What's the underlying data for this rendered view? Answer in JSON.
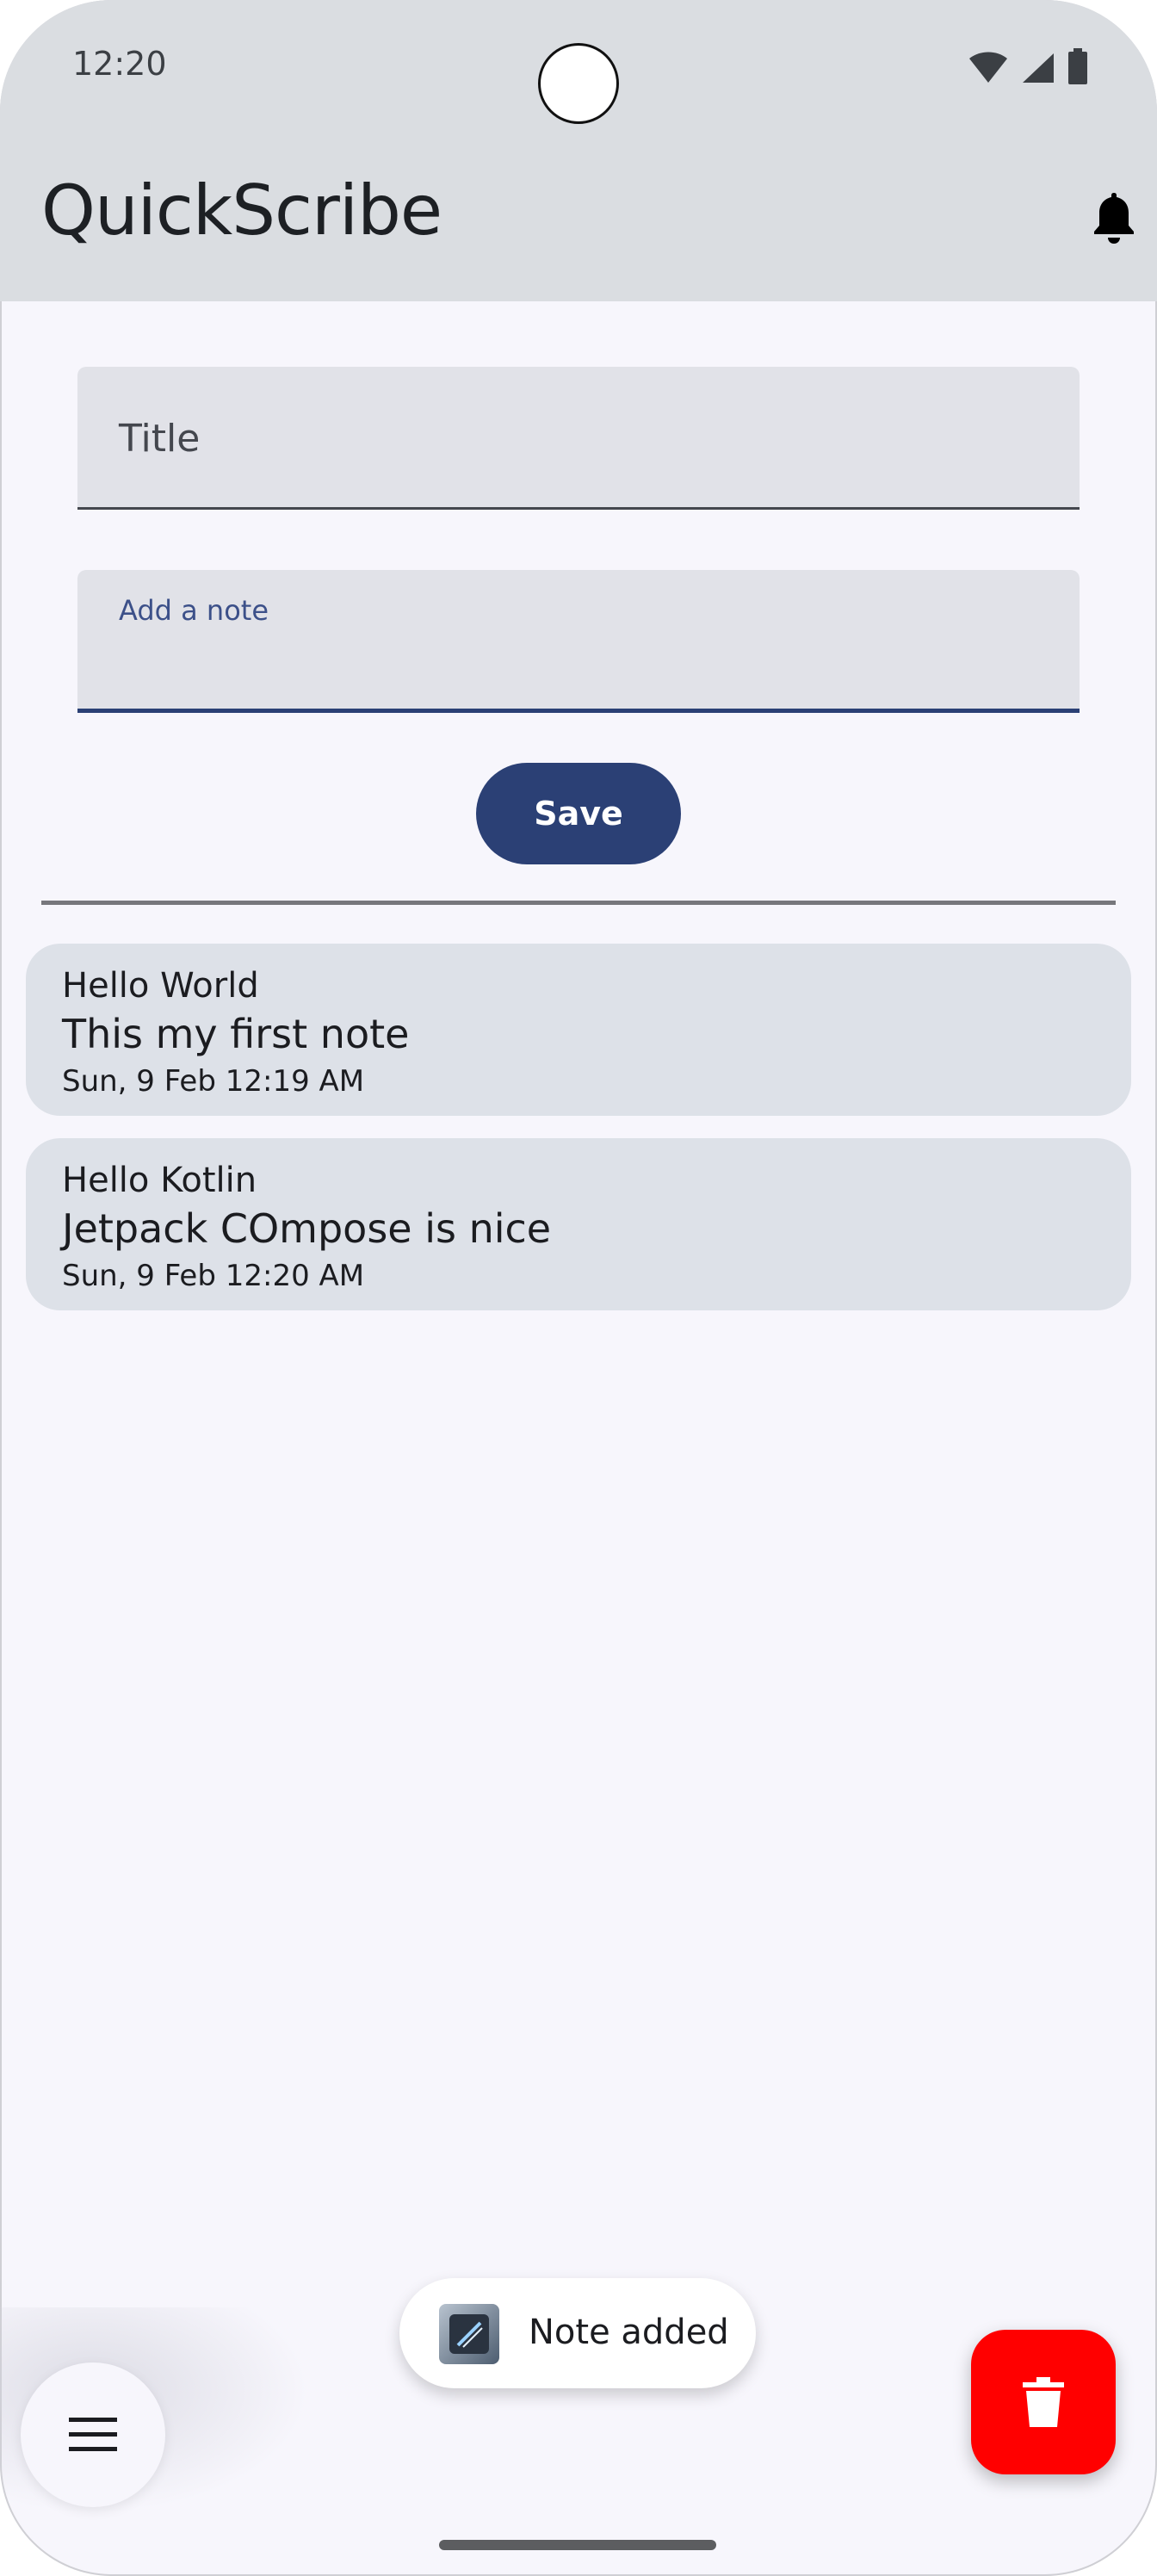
{
  "status_bar": {
    "time": "12:20",
    "icons": [
      "wifi-icon",
      "cellular-signal-icon",
      "battery-icon"
    ]
  },
  "app_bar": {
    "title": "QuickScribe",
    "action_icon": "notification-bell-icon"
  },
  "form": {
    "title_placeholder": "Title",
    "note_label": "Add a note",
    "save_label": "Save"
  },
  "notes": [
    {
      "title": "Hello World",
      "body": "This my first note",
      "date": "Sun, 9 Feb 12:19 AM"
    },
    {
      "title": "Hello Kotlin",
      "body": "Jetpack COmpose is nice",
      "date": "Sun, 9 Feb 12:20 AM"
    }
  ],
  "toast": {
    "message": "Note added",
    "icon": "app-icon"
  },
  "fab": {
    "icon": "trash-icon",
    "color": "#ff0000"
  },
  "menu_button": {
    "icon": "menu-icon"
  },
  "colors": {
    "primary": "#2b4075",
    "top_bar": "#dadde1",
    "background": "#f7f6fc",
    "card": "#dde1e8",
    "delete": "#ff0000"
  }
}
